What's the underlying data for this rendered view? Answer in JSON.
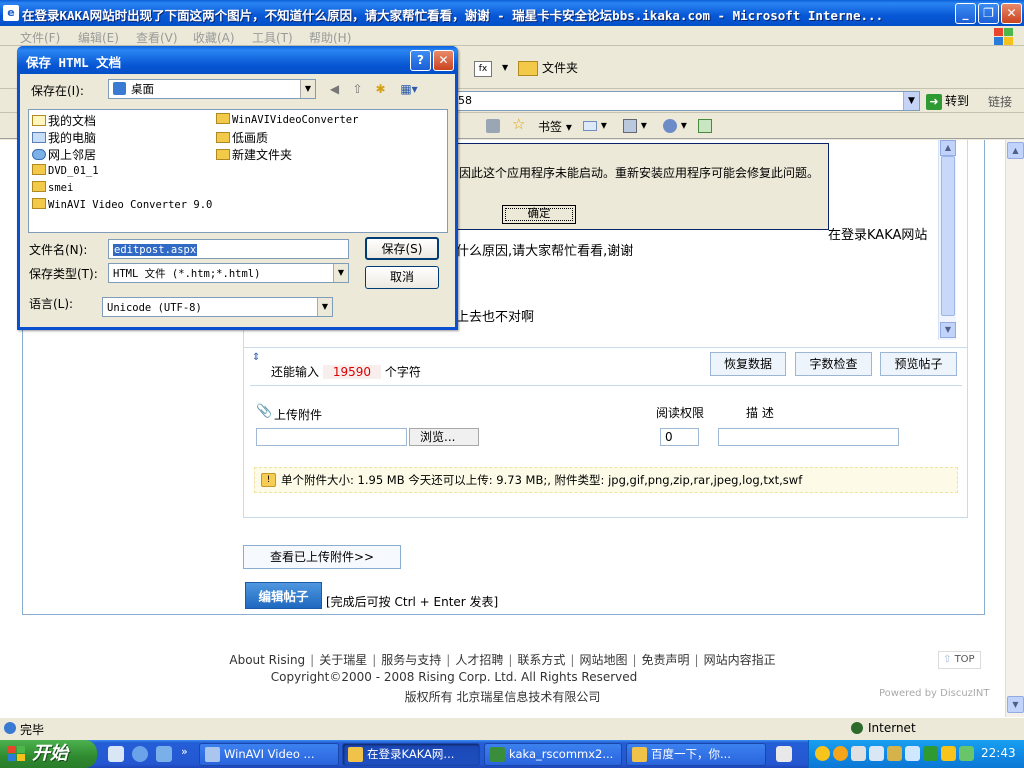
{
  "window": {
    "title": "在登录KAKA网站时出现了下面这两个图片，不知道什么原因，请大家帮忙看看，谢谢 - 瑞星卡卡安全论坛bbs.ikaka.com - Microsoft Interne..."
  },
  "menubar": {
    "items": [
      "文件(F)",
      "编辑(E)",
      "查看(V)",
      "收藏(A)",
      "工具(T)",
      "帮助(H)"
    ]
  },
  "toolbar": {
    "folders_label": "文件夹",
    "go_label": "转到",
    "links_label": "链接",
    "address_value": "58",
    "bookmarks_label": "书签"
  },
  "error_dialog": {
    "message": "因此这个应用程序未能启动。重新安装应用程序可能会修复此问题。",
    "ok_label": "确定"
  },
  "save_dialog": {
    "title": "保存 HTML 文档",
    "save_in_label": "保存在(I):",
    "save_in_value": "桌面",
    "files": [
      "我的文档",
      "我的电脑",
      "网上邻居",
      "DVD_01_1",
      "smei",
      "WinAVI Video Converter 9.0",
      "WinAVIVideoConverter",
      "低画质",
      "新建文件夹"
    ],
    "filename_label": "文件名(N):",
    "filename_value": "editpost.aspx",
    "filetype_label": "保存类型(T):",
    "filetype_value": "HTML 文件 (*.htm;*.html)",
    "encoding_label": "语言(L):",
    "encoding_value": "Unicode (UTF-8)",
    "save_button": "保存(S)",
    "cancel_button": "取消"
  },
  "editor": {
    "line1": "在登录KAKA网站",
    "line2": "什么原因,请大家帮忙看看,谢谢",
    "line3": "上去也不对啊",
    "remaining_label": "还能输入",
    "remaining_count": "19590",
    "remaining_unit": "个字符",
    "restore_button": "恢复数据",
    "count_button": "字数检查",
    "preview_button": "预览帖子"
  },
  "attachment": {
    "upload_label": "上传附件",
    "browse_button": "浏览...",
    "permission_label": "阅读权限",
    "permission_value": "0",
    "desc_label": "描 述",
    "notice": "单个附件大小: 1.95 MB  今天还可以上传: 9.73 MB;,  附件类型:  jpg,gif,png,zip,rar,jpeg,log,txt,swf",
    "view_uploaded_button": "查看已上传附件>>"
  },
  "post": {
    "edit_button": "编辑帖子",
    "hint": "[完成后可按 Ctrl + Enter 发表]"
  },
  "footer": {
    "links": [
      "About Rising",
      "关于瑞星",
      "服务与支持",
      "人才招聘",
      "联系方式",
      "网站地图",
      "免责声明",
      "网站内容指正"
    ],
    "copyright": "Copyright©2000 - 2008 Rising Corp. Ltd.  All Rights Reserved",
    "company": "版权所有 北京瑞星信息技术有限公司",
    "top_label": "TOP",
    "powered": "Powered by DiscuzINT"
  },
  "statusbar": {
    "status": "完毕",
    "zone": "Internet"
  },
  "taskbar": {
    "start_label": "开始",
    "tasks": [
      "WinAVI Video ...",
      "在登录KAKA网...",
      "kaka_rscommx2...",
      "百度一下，你..."
    ],
    "clock": "22:43"
  }
}
